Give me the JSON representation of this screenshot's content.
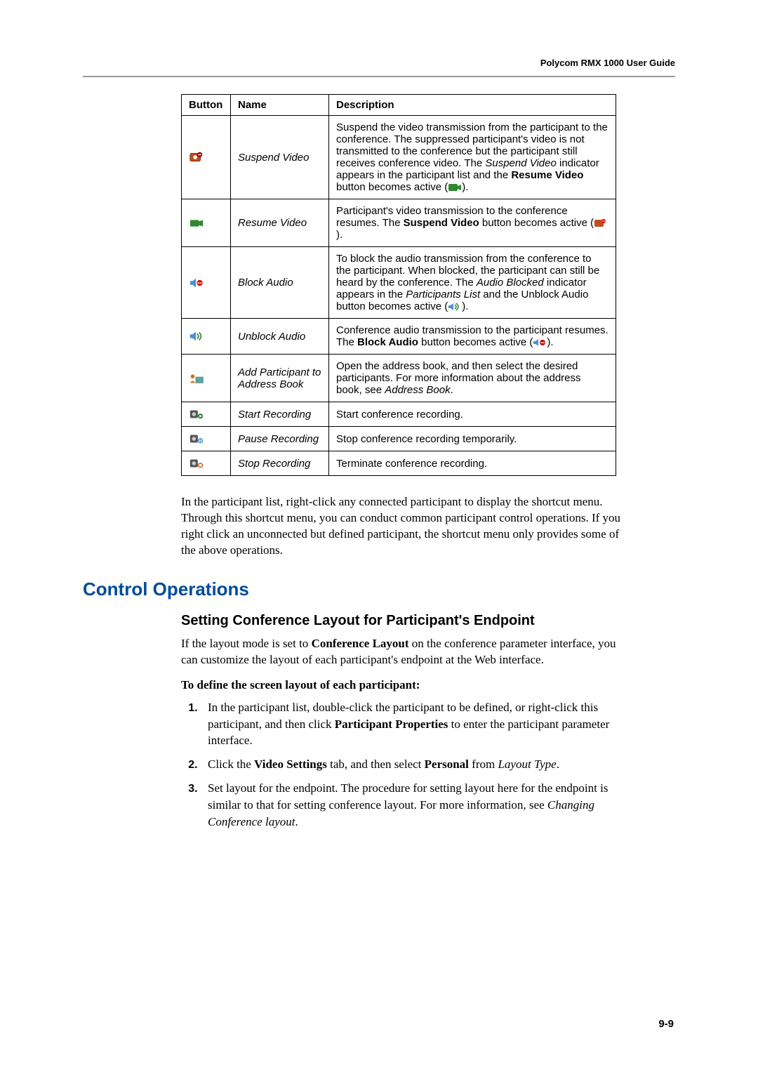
{
  "header": {
    "doc_title": "Polycom RMX 1000 User Guide"
  },
  "table": {
    "headers": {
      "c1": "Button",
      "c2": "Name",
      "c3": "Description"
    },
    "rows": [
      {
        "icon": "suspend-video-icon",
        "name": "Suspend Video",
        "desc_pre": "Suspend the video transmission from the participant to the conference. The suppressed participant's video is not transmitted to the conference but the participant still receives conference video. The ",
        "desc_em1": "Suspend Video",
        "desc_mid": " indicator appears in the participant list and the ",
        "desc_b1": "Resume Video",
        "desc_post": " button becomes active (",
        "desc_close": ")."
      },
      {
        "icon": "resume-video-icon",
        "name": "Resume Video",
        "desc_pre": "Participant's video transmission to the conference resumes. The ",
        "desc_b1": "Suspend Video",
        "desc_post": " button becomes active (",
        "desc_close": ")."
      },
      {
        "icon": "block-audio-icon",
        "name": "Block Audio",
        "desc_pre": "To block the audio transmission from the conference to the participant. When blocked, the participant can still be heard by the conference. The ",
        "desc_em1": "Audio Blocked",
        "desc_mid": " indicator appears in the ",
        "desc_em2": "Participants List",
        "desc_post": " and the Unblock Audio button becomes active (",
        "desc_close": ")."
      },
      {
        "icon": "unblock-audio-icon",
        "name": "Unblock Audio",
        "desc_pre": "Conference audio transmission to the participant resumes. The ",
        "desc_b1": "Block Audio",
        "desc_post": " button becomes active (",
        "desc_close": ")."
      },
      {
        "icon": "add-participant-icon",
        "name": "Add Participant to Address Book",
        "desc_pre": "Open the address book, and then select the desired participants. For more information about the address book, see ",
        "desc_em1": "Address Book",
        "desc_close": "."
      },
      {
        "icon": "start-recording-icon",
        "name": "Start Recording",
        "desc_pre": "Start conference recording."
      },
      {
        "icon": "pause-recording-icon",
        "name": "Pause Recording",
        "desc_pre": "Stop conference recording temporarily."
      },
      {
        "icon": "stop-recording-icon",
        "name": "Stop Recording",
        "desc_pre": "Terminate conference recording."
      }
    ]
  },
  "body_para": "In the participant list, right-click any connected participant to display the shortcut menu. Through this shortcut menu, you can conduct common participant control operations. If you right click an unconnected but defined participant, the shortcut menu only provides some of the above operations.",
  "section_heading": "Control Operations",
  "subsection_heading": "Setting Conference Layout for Participant's Endpoint",
  "intro_pre": "If the layout mode is set to ",
  "intro_b1": "Conference Layout",
  "intro_post": " on the conference parameter interface, you can customize the layout of each participant's endpoint at the Web interface.",
  "define_line": "To define the screen layout of each participant:",
  "steps": {
    "s1_pre": "In the participant list, double-click the participant to be defined, or right-click this participant, and then click ",
    "s1_b1": "Participant Properties",
    "s1_post": " to enter the participant parameter interface.",
    "s2_pre": "Click the ",
    "s2_b1": "Video Settings",
    "s2_mid": " tab, and then select ",
    "s2_b2": "Personal",
    "s2_post_pre": " from ",
    "s2_em1": "Layout Type",
    "s2_close": ".",
    "s3_pre": "Set layout for the endpoint. The procedure for setting layout here for the endpoint is similar to that for setting conference layout. For more information, see ",
    "s3_em1": "Changing Conference layout",
    "s3_close": "."
  },
  "pagenum": "9-9"
}
